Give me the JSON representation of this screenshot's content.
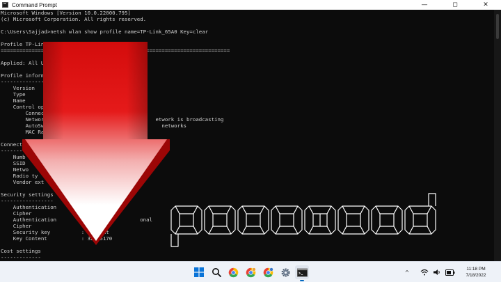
{
  "window": {
    "title": "Command Prompt",
    "controls": {
      "minimize": "—",
      "maximize": "◻",
      "close": "✕"
    }
  },
  "console_lines": [
    "Microsoft Windows [Version 10.0.22000.795]",
    "(c) Microsoft Corporation. All rights reserved.",
    "",
    "C:\\Users\\Sajjad>netsh wlan show profile name=TP-Link_65A0 Key=clear",
    "",
    "Profile TP-Link_",
    "==========================================================================",
    "",
    "Applied: All Us",
    "",
    "Profile informa",
    "---------------",
    "    Version",
    "    Type",
    "    Name",
    "    Control opt",
    "        Connect",
    "        Network                                   etwork is broadcasting",
    "        AutoSw                                      networks",
    "        MAC Ran",
    "",
    "Connecti",
    "--------",
    "    Numb",
    "    SSID",
    "    Netwo",
    "    Radio ty",
    "    Vendor ext",
    "",
    "Security settings",
    "-----------------",
    "    Authentication",
    "    Cipher",
    "    Authentication                           onal",
    "    Cipher                : C",
    "    Security key          : Present",
    "    Key Content           : 32645170",
    "",
    "Cost settings",
    "-------------"
  ],
  "overlay_word": "password",
  "taskbar": {
    "pinned": [
      {
        "name": "start-button-icon"
      },
      {
        "name": "search-icon"
      },
      {
        "name": "chrome-icon"
      },
      {
        "name": "chrome-profile-icon"
      },
      {
        "name": "chrome-profile-2-icon"
      },
      {
        "name": "settings-icon"
      },
      {
        "name": "command-prompt-icon",
        "active": true
      }
    ],
    "tray": {
      "chevron": "^",
      "time": "11:18 PM",
      "date": "7/18/2022"
    }
  },
  "colors": {
    "console_bg": "#0c0c0c",
    "console_text": "#cfcfcf",
    "arrow_red": "#e01010",
    "taskbar_bg": "#eef2f8",
    "accent": "#0067c0"
  }
}
